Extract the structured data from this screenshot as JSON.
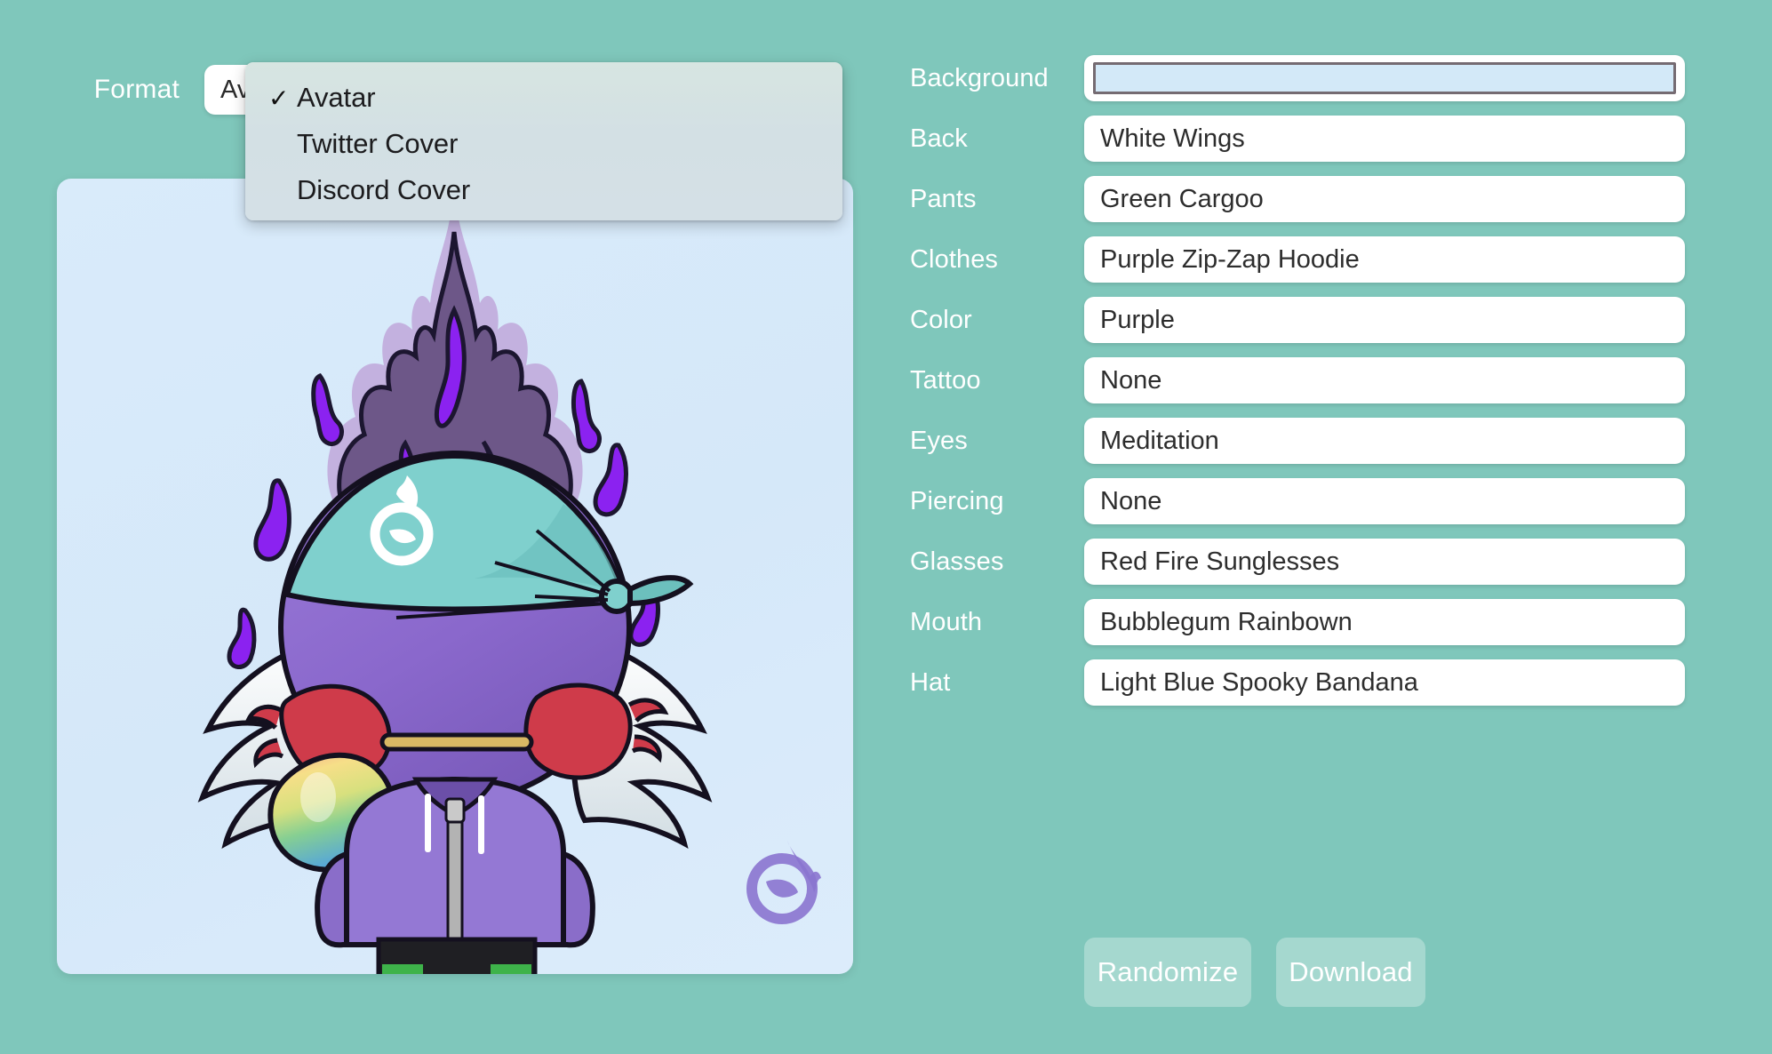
{
  "theme": {
    "page_background": "#7fc7bb",
    "card_background": "#d9ebfa",
    "field_background": "#ffffff",
    "label_color": "#ffffff",
    "dropdown_background": "#d5e2e3",
    "button_background": "rgba(255,255,255,0.30)",
    "swatch_border": "#756b72"
  },
  "format": {
    "label": "Format",
    "selected": "Avatar",
    "options": [
      {
        "label": "Avatar",
        "checked": true,
        "check_glyph": "✓"
      },
      {
        "label": "Twitter Cover",
        "checked": false,
        "check_glyph": ""
      },
      {
        "label": "Discord Cover",
        "checked": false,
        "check_glyph": ""
      }
    ]
  },
  "traits": [
    {
      "label": "Background",
      "value": "",
      "type": "color",
      "color": "#d3e9f8"
    },
    {
      "label": "Back",
      "value": "White Wings",
      "type": "text"
    },
    {
      "label": "Pants",
      "value": "Green Cargoo",
      "type": "text"
    },
    {
      "label": "Clothes",
      "value": "Purple Zip-Zap Hoodie",
      "type": "text"
    },
    {
      "label": "Color",
      "value": "Purple",
      "type": "text"
    },
    {
      "label": "Tattoo",
      "value": "None",
      "type": "text"
    },
    {
      "label": "Eyes",
      "value": "Meditation",
      "type": "text"
    },
    {
      "label": "Piercing",
      "value": "None",
      "type": "text"
    },
    {
      "label": "Glasses",
      "value": "Red Fire Sunglesses",
      "type": "text"
    },
    {
      "label": "Mouth",
      "value": "Bubblegum Rainbown",
      "type": "text"
    },
    {
      "label": "Hat",
      "value": "Light Blue Spooky Bandana",
      "type": "text"
    }
  ],
  "actions": {
    "randomize_label": "Randomize",
    "download_label": "Download"
  },
  "avatar": {
    "name": "purple-flame-character",
    "description": "Purple flame-headed character wearing a light blue spooky bandana, red fire sunglasses, purple zip-zap hoodie, white wings and blowing a rainbow bubblegum",
    "watermark": "flame-logo",
    "colors": {
      "flame_outer": "#c0aedd",
      "flame_mid": "#6d5788",
      "flame_bright": "#8b22f0",
      "head": "#8e6fd0",
      "head_dark": "#7354b4",
      "bandana": "#7fd0cd",
      "bandana_dark": "#68b8b8",
      "sunglasses": "#cf3b4a",
      "hoodie": "#9478d4",
      "hoodie_dark": "#7a5fbb",
      "pants": "#1f1f23",
      "shoes": "#3eb34a",
      "wing": "#ffffff",
      "wing_shade": "#ccd8df",
      "outline": "#14101f"
    }
  }
}
